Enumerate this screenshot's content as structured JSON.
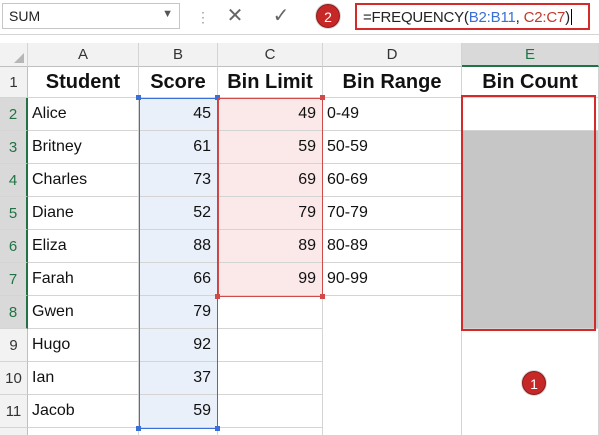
{
  "formula_bar": {
    "name_box": "SUM",
    "cancel_glyph": "✕",
    "enter_glyph": "✓",
    "formula_text": "=FREQUENCY(B2:B11, C2:C7)",
    "formula_prefix": "=FREQUENCY(",
    "formula_arg1": "B2:B11",
    "formula_sep": ", ",
    "formula_arg2": "C2:C7",
    "formula_suffix": ")"
  },
  "annotations": {
    "badge_formula": "2",
    "badge_range": "1"
  },
  "columns": [
    "A",
    "B",
    "C",
    "D",
    "E"
  ],
  "rows": [
    "1",
    "2",
    "3",
    "4",
    "5",
    "6",
    "7",
    "8",
    "9",
    "10",
    "11"
  ],
  "headers": {
    "student": "Student",
    "score": "Score",
    "bin_limit": "Bin Limit",
    "bin_range": "Bin Range",
    "bin_count": "Bin Count"
  },
  "students": [
    "Alice",
    "Britney",
    "Charles",
    "Diane",
    "Eliza",
    "Farah",
    "Gwen",
    "Hugo",
    "Ian",
    "Jacob"
  ],
  "scores": [
    "45",
    "61",
    "73",
    "52",
    "88",
    "66",
    "79",
    "92",
    "37",
    "59"
  ],
  "bin_limits": [
    "49",
    "59",
    "69",
    "79",
    "89",
    "99"
  ],
  "bin_ranges": [
    "0-49",
    "50-59",
    "60-69",
    "70-79",
    "80-89",
    "90-99"
  ],
  "colors": {
    "accent_red": "#d42a2a",
    "range_blue": "#3a6fd8",
    "excel_green": "#217346",
    "selection_grey": "#c6c6c6"
  }
}
